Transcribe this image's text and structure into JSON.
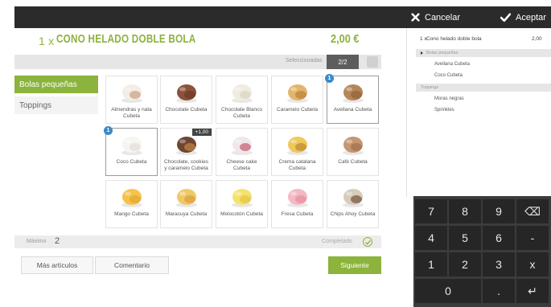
{
  "topbar": {
    "cancel_label": "Cancelar",
    "accept_label": "Aceptar"
  },
  "product": {
    "qty": "1 x",
    "name": "CONO HELADO DOBLE BOLA",
    "price": "2,00 €"
  },
  "selection": {
    "label": "Seleccionadas",
    "count": "2/2"
  },
  "categories": [
    {
      "label": "Bolas pequeñas",
      "active": true
    },
    {
      "label": "Toppings",
      "active": false
    }
  ],
  "products": [
    {
      "label": "Almendras y nata Cubeta",
      "selected": false
    },
    {
      "label": "Chocolate Cubeta",
      "selected": false
    },
    {
      "label": "Chocolate Blanco Cubeta",
      "selected": false
    },
    {
      "label": "Caramelo Cubeta",
      "selected": false
    },
    {
      "label": "Avellana Cubeta",
      "selected": true,
      "badge": "1"
    },
    {
      "label": "Coco Cubeta",
      "selected": true,
      "badge": "1"
    },
    {
      "label": "Chocolate, cookies y caramelo Cubeta",
      "selected": false,
      "surcharge": "+1,00"
    },
    {
      "label": "Cheese cake Cubeta",
      "selected": false
    },
    {
      "label": "Crema catalana Cubeta",
      "selected": false
    },
    {
      "label": "Café Cubeta",
      "selected": false
    },
    {
      "label": "Mango Cubeta",
      "selected": false
    },
    {
      "label": "Maracuya Cubeta",
      "selected": false
    },
    {
      "label": "Melocotón Cubeta",
      "selected": false
    },
    {
      "label": "Fresa Cubeta",
      "selected": false
    },
    {
      "label": "Chips Ahoy Cubeta",
      "selected": false
    }
  ],
  "status": {
    "max_label": "Máximo",
    "max_value": "2",
    "completed_label": "Completado"
  },
  "buttons": {
    "more_items": "Más artículos",
    "comment": "Comentario",
    "next": "Siguiente"
  },
  "order": {
    "qty": "1 x",
    "name": "Cono helado doble bola",
    "price": "2,00",
    "groups": [
      {
        "name": "Bolas pequeñas",
        "items": [
          "Avellana Cubeta",
          "Coco Cubeta"
        ]
      },
      {
        "name": "Toppings",
        "items": [
          "Moras negras",
          "Sprinkles"
        ]
      }
    ]
  },
  "keypad": {
    "keys": [
      "7",
      "8",
      "9",
      "⌫",
      "4",
      "5",
      "6",
      "-",
      "1",
      "2",
      "3",
      "x",
      "0",
      ".",
      "↵"
    ]
  },
  "colors": {
    "accent_green": "#8cb33c",
    "topbar": "#2b2b2b",
    "keypad_bg": "#3b3b3b",
    "key_bg": "#262626",
    "badge_blue": "#3c89c8"
  }
}
